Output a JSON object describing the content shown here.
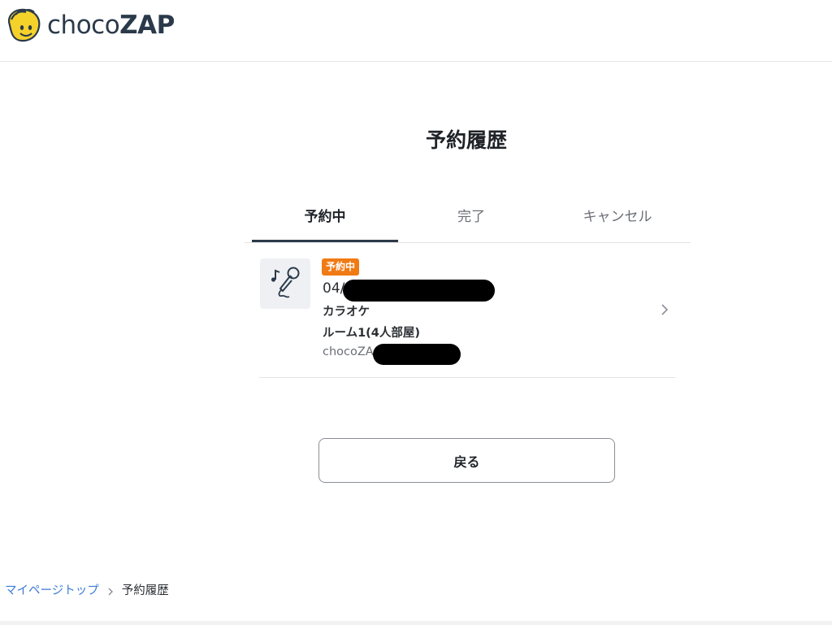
{
  "brand": {
    "logo_text_light": "choco",
    "logo_text_bold": "ZAP",
    "colors": {
      "brand_text": "#2b3a4a",
      "logo_yellow": "#f5d22a",
      "accent": "#f07a14",
      "link": "#3a7bd5"
    }
  },
  "page": {
    "title": "予約履歴"
  },
  "tabs": [
    {
      "label": "予約中",
      "active": true
    },
    {
      "label": "完了",
      "active": false
    },
    {
      "label": "キャンセル",
      "active": false
    }
  ],
  "reservation": {
    "icon": "karaoke-microphone-icon",
    "status_badge": "予約中",
    "date_visible": "04/",
    "category": "カラオケ",
    "room": "ルーム1(4人部屋)",
    "store_visible": "chocoZA"
  },
  "actions": {
    "back_label": "戻る"
  },
  "breadcrumb": {
    "items": [
      {
        "label": "マイページトップ",
        "link": true
      },
      {
        "label": "予約履歴",
        "link": false
      }
    ]
  }
}
